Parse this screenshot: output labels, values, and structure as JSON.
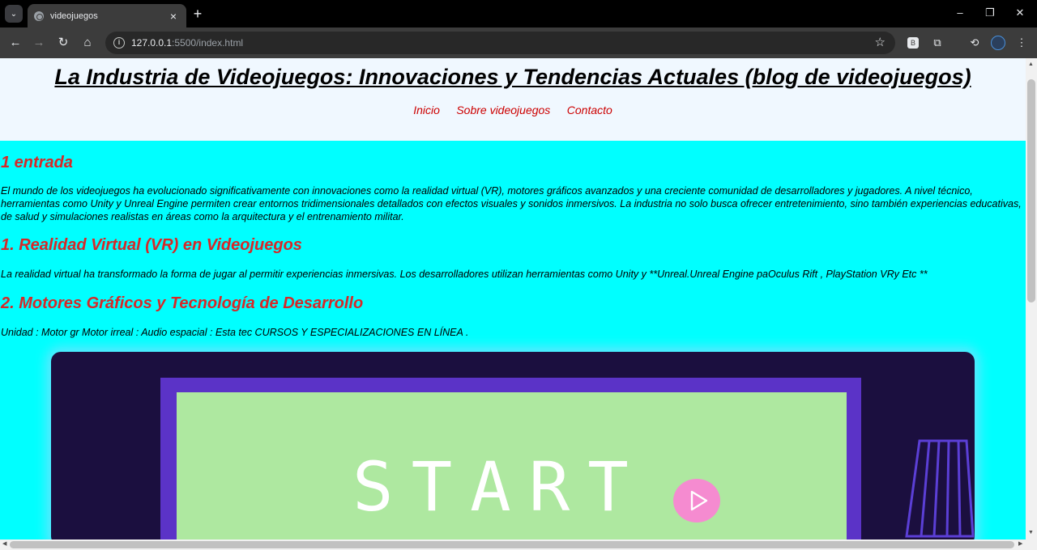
{
  "browser": {
    "tab_title": "videojuegos",
    "url_host": "127.0.0.1",
    "url_rest": ":5500/index.html",
    "new_tab_label": "+",
    "close_tab_label": "×"
  },
  "header": {
    "title": "La Industria de Videojuegos: Innovaciones y Tendencias Actuales (blog de videojuegos)",
    "nav": [
      "Inicio",
      "Sobre videojuegos",
      "Contacto"
    ]
  },
  "sections": [
    {
      "heading": "1 entrada",
      "text": "El mundo de los videojuegos ha evolucionado significativamente con innovaciones como la realidad virtual (VR), motores gráficos avanzados y una creciente comunidad de desarrolladores y jugadores. A nivel técnico, herramientas como Unity y Unreal Engine permiten crear entornos tridimensionales detallados con efectos visuales y sonidos inmersivos. La industria no solo busca ofrecer entretenimiento, sino también experiencias educativas, de salud y simulaciones realistas en áreas como la arquitectura y el entrenamiento militar."
    },
    {
      "heading": "1. Realidad Virtual (VR) en Videojuegos",
      "text": "La realidad virtual ha transformado la forma de jugar al permitir experiencias inmersivas. Los desarrolladores utilizan herramientas como Unity y **Unreal.Unreal Engine paOculus Rift , PlayStation VRy Etc **"
    },
    {
      "heading": "2. Motores Gráficos y Tecnología de Desarrollo",
      "text": "Unidad : Motor gr Motor irreal : Audio espacial : Esta tec CURSOS Y ESPECIALIZACIONES EN LÍNEA ."
    }
  ],
  "hero_image": {
    "text": "START",
    "colors": {
      "background": "#1b0f3f",
      "frame": "#5b33c7",
      "screen": "#aee8a0",
      "play": "#f58bd0",
      "glow": "#5fe8ff"
    }
  },
  "colors": {
    "page_bg": "#00ffff",
    "header_bg": "#f0f8ff",
    "heading": "#d62828",
    "nav_link": "#cc0000"
  }
}
